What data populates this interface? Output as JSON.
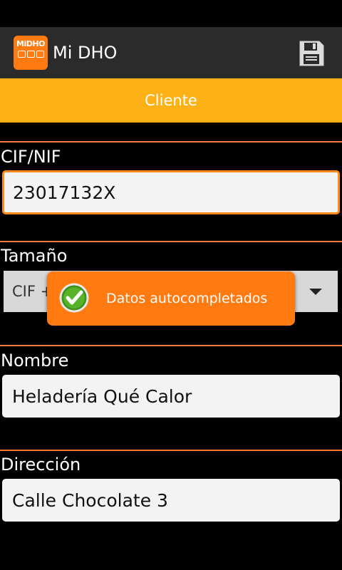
{
  "actionbar": {
    "title": "Mi DHO",
    "logo_text": "MiDHO"
  },
  "tabs": [
    {
      "label": "Cliente"
    }
  ],
  "form": {
    "cif": {
      "label": "CIF/NIF",
      "value": "23017132X"
    },
    "tamano": {
      "label": "Tamaño",
      "selected": "CIF +"
    },
    "nombre": {
      "label": "Nombre",
      "value": "Heladería Qué Calor"
    },
    "direccion": {
      "label": "Dirección",
      "value": "Calle Chocolate 3"
    }
  },
  "toast": {
    "message": "Datos autocompletados"
  },
  "colors": {
    "accent": "#ff7a10",
    "tab": "#fcb116",
    "divider": "#ff7a3a"
  }
}
